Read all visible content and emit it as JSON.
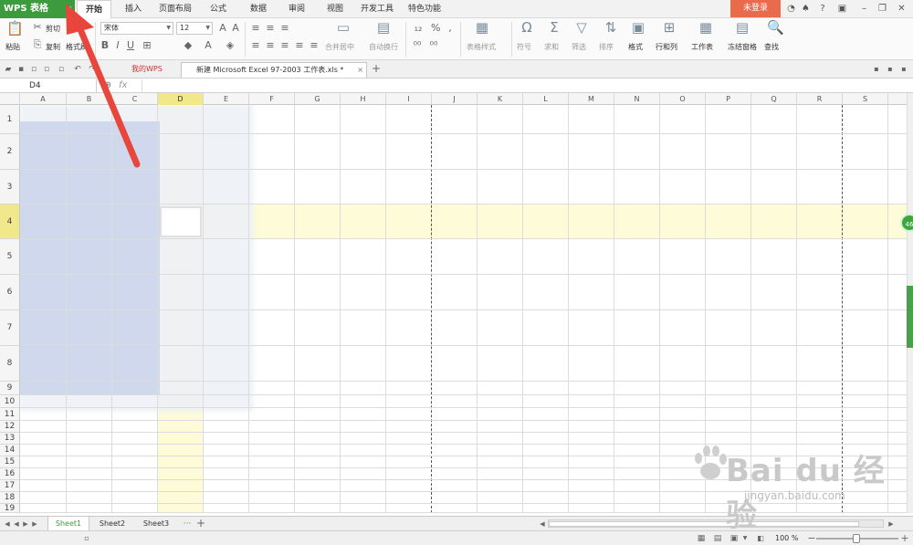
{
  "app": {
    "brand": "WPS 表格"
  },
  "menu_tabs": [
    {
      "label": "开始",
      "active": true
    },
    {
      "label": "插入"
    },
    {
      "label": "页面布局"
    },
    {
      "label": "公式"
    },
    {
      "label": "数据"
    },
    {
      "label": "审阅"
    },
    {
      "label": "视图"
    },
    {
      "label": "开发工具"
    },
    {
      "label": "特色功能"
    }
  ],
  "login_label": "未登录",
  "ribbon": {
    "paste": "粘贴",
    "cut": "剪切",
    "copy": "复制",
    "format_painter": "格式刷",
    "font_name": "宋体",
    "font_size": "12",
    "merge_center": "合并居中",
    "wrap_text": "自动换行",
    "table_style": "表格样式",
    "symbol": "符号",
    "sum": "求和",
    "filter": "筛选",
    "sort": "排序",
    "format": "格式",
    "row_col": "行和列",
    "worksheet": "工作表",
    "freeze": "冻结窗格",
    "find": "查找",
    "percent": "%",
    "bold": "B",
    "italic": "I",
    "underline": "U"
  },
  "doc_tabs": [
    {
      "label": "我的WPS"
    },
    {
      "label": "新建 Microsoft Excel 97-2003 工作表.xls *",
      "active": true
    }
  ],
  "formula_bar": {
    "name_box": "D4",
    "fx": "fx"
  },
  "columns": [
    "A",
    "B",
    "C",
    "D",
    "E",
    "F",
    "G",
    "H",
    "I",
    "J",
    "K",
    "L",
    "M",
    "N",
    "O",
    "P",
    "Q",
    "R",
    "S"
  ],
  "selected_column": "D",
  "rows": [
    "1",
    "2",
    "3",
    "4",
    "5",
    "6",
    "7",
    "8",
    "9",
    "10",
    "11",
    "12",
    "13",
    "14",
    "15",
    "16",
    "17",
    "18",
    "19"
  ],
  "selected_row": "4",
  "sheets": [
    {
      "label": "Sheet1",
      "active": true
    },
    {
      "label": "Sheet2"
    },
    {
      "label": "Sheet3"
    }
  ],
  "status": {
    "zoom": "100 %"
  },
  "side_badge": "46",
  "watermark": {
    "main": "Bai du 经验",
    "sub": "jingyan.baidu.com"
  },
  "colors": {
    "brand_green": "#3c9b3c",
    "login_orange": "#e86b4c",
    "selection_yellow": "#fdfbd8",
    "arrow_red": "#e8453c"
  }
}
